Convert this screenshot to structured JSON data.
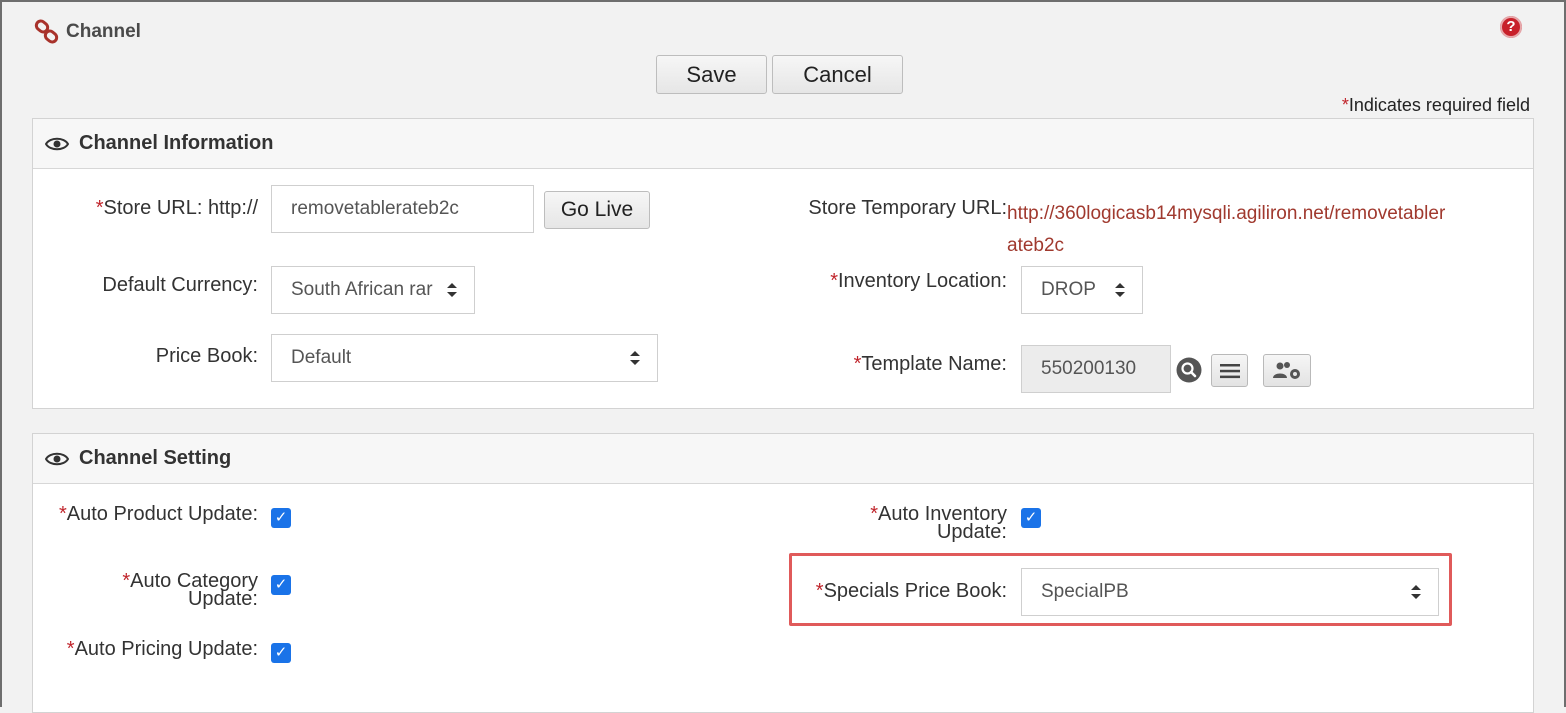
{
  "header": {
    "title": "Channel",
    "help_icon": "help-icon"
  },
  "actions": {
    "save_label": "Save",
    "cancel_label": "Cancel"
  },
  "required_note": {
    "star": "*",
    "text": "Indicates required field"
  },
  "channel_information": {
    "title": "Channel Information",
    "store_url": {
      "label": "Store URL: http://",
      "value": "removetablerateb2c",
      "go_live_label": "Go Live",
      "required": true
    },
    "default_currency": {
      "label": "Default Currency:",
      "value": "South African rar"
    },
    "price_book": {
      "label": "Price Book:",
      "value": "Default"
    },
    "store_temp_url": {
      "label": "Store Temporary URL:",
      "line1": "http://360logicasb14mysqli.agiliron.net/removetabler",
      "line2": "ateb2c"
    },
    "inventory_location": {
      "label": "Inventory Location:",
      "value": "DROP",
      "required": true
    },
    "template_name": {
      "label": "Template Name:",
      "value": "550200130",
      "required": true
    }
  },
  "channel_setting": {
    "title": "Channel Setting",
    "auto_product_update": {
      "label": "Auto Product Update:",
      "checked": true
    },
    "auto_category_update": {
      "label_line1": "Auto Category",
      "label_line2": "Update:",
      "checked": true
    },
    "auto_pricing_update": {
      "label": "Auto Pricing Update:",
      "checked": true
    },
    "auto_inventory_update": {
      "label_line1": "Auto Inventory",
      "label_line2": "Update:",
      "checked": true
    },
    "specials_price_book": {
      "label": "Specials Price Book:",
      "value": "SpecialPB"
    }
  },
  "colors": {
    "required_star": "#c0242b",
    "link": "#a0392e",
    "checkbox": "#1a73e8",
    "highlight": "#e05a5a"
  }
}
